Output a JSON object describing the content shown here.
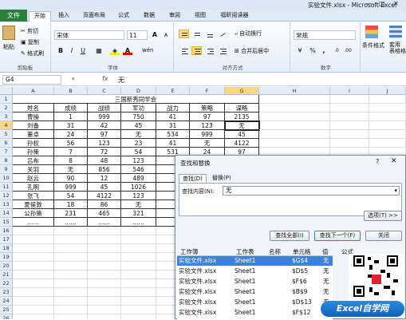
{
  "window": {
    "title": "实验文件.xlsx - Microsoft Excel",
    "minimize": "—",
    "restore": "□",
    "close": "✕"
  },
  "tabs": [
    "文件",
    "开始",
    "插入",
    "页面布局",
    "公式",
    "数据",
    "审阅",
    "视图",
    "福昕阅读器"
  ],
  "ribbon": {
    "clipboard": {
      "paste": "粘贴",
      "cut": "剪切",
      "copy": "复制",
      "format_painter": "格式刷",
      "label": "剪贴板"
    },
    "font": {
      "name": "宋体",
      "size": "11",
      "bold": "B",
      "italic": "I",
      "underline": "U",
      "grow": "A",
      "shrink": "A",
      "color": "A",
      "label": "字体"
    },
    "alignment": {
      "wrap": "自动换行",
      "merge": "合并后居中",
      "label": "对齐方式"
    },
    "number": {
      "format": "常规",
      "percent": "%",
      "comma": ",",
      "label": "数字"
    },
    "styles": {
      "conditional": "条件格式",
      "table": "套用\n表格格"
    }
  },
  "formula_bar": {
    "name_box": "G4",
    "fx": "fx",
    "value": "无"
  },
  "sheet": {
    "columns": [
      "A",
      "B",
      "C",
      "D",
      "E",
      "F",
      "G",
      "H",
      "I",
      "J"
    ],
    "title": "三国新秀同学会",
    "headers": [
      "姓名",
      "成绩",
      "战绩",
      "军功",
      "战力",
      "策略",
      "谋略"
    ],
    "rows": [
      [
        "曹操",
        "1",
        "999",
        "750",
        "41",
        "97",
        "2135"
      ],
      [
        "刘备",
        "31",
        "42",
        "45",
        "31",
        "123",
        "无"
      ],
      [
        "董卓",
        "24",
        "97",
        "无",
        "534",
        "999",
        "45"
      ],
      [
        "孙权",
        "56",
        "123",
        "23",
        "41",
        "无",
        "4122"
      ],
      [
        "孙策",
        "7",
        "72",
        "54",
        "531",
        "24",
        "97"
      ],
      [
        "吕布",
        "8",
        "48",
        "123",
        "",
        "",
        ""
      ],
      [
        "关羽",
        "无",
        "856",
        "546",
        "",
        "",
        ""
      ],
      [
        "赵云",
        "90",
        "12",
        "489",
        "",
        "",
        ""
      ],
      [
        "孔明",
        "999",
        "45",
        "1026",
        "",
        "",
        ""
      ],
      [
        "张飞",
        "54",
        "4122",
        "123",
        "",
        "",
        ""
      ],
      [
        "夏侯敦",
        "18",
        "86",
        "无",
        "",
        "",
        ""
      ],
      [
        "公孙策",
        "231",
        "465",
        "321",
        "",
        "",
        ""
      ],
      [
        "……",
        "……",
        "……",
        "……",
        "",
        "",
        ""
      ]
    ]
  },
  "dialog": {
    "title": "查找和替换",
    "help": "?",
    "close": "✕",
    "tab_find": "查找(D)",
    "tab_replace": "替换(P)",
    "find_label": "查找内容(N):",
    "find_value": "无",
    "options_btn": "选项(T) >>",
    "find_all_btn": "查找全部(I)",
    "find_next_btn": "查找下一个(F)",
    "close_btn": "关闭",
    "result_headers": [
      "工作簿",
      "工作表",
      "名称",
      "单元格",
      "值",
      "公式"
    ],
    "results": [
      [
        "实验文件.xlsx",
        "Sheet1",
        "$G$4",
        "无"
      ],
      [
        "实验文件.xlsx",
        "Sheet1",
        "$D$5",
        "无"
      ],
      [
        "实验文件.xlsx",
        "Sheet1",
        "$F$6",
        "无"
      ],
      [
        "实验文件.xlsx",
        "Sheet1",
        "$B$9",
        "无"
      ],
      [
        "实验文件.xlsx",
        "Sheet1",
        "$D$13",
        "无"
      ],
      [
        "实验文件.xlsx",
        "Sheet1",
        "$F$12",
        "无"
      ]
    ]
  },
  "watermark": "Excel自学网"
}
